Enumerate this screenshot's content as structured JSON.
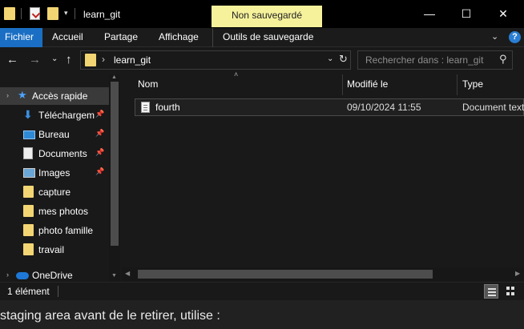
{
  "titlebar": {
    "title": "learn_git",
    "contextual_tab": "Non sauvegardé",
    "qa_dropdown": "▾",
    "controls": {
      "minimize": "—",
      "maximize": "☐",
      "close": "✕"
    }
  },
  "ribbon": {
    "tabs": [
      "Fichier",
      "Accueil",
      "Partage",
      "Affichage",
      "Outils de sauvegarde"
    ],
    "active_tab": "Fichier",
    "active_color": "#1a6fc4",
    "collapse_icon": "⌄",
    "help_icon": "?"
  },
  "navbar": {
    "back": "←",
    "forward": "→",
    "recent": "⌄",
    "up": "↑",
    "path_separator": "›",
    "path": "learn_git",
    "dropdown": "⌄",
    "refresh": "↻",
    "search_placeholder": "Rechercher dans : learn_git",
    "search_icon": "⚲"
  },
  "sidebar": {
    "items": [
      {
        "label": "Accès rapide",
        "icon": "star-icon",
        "glyph": "★",
        "pinned": false,
        "selected": true,
        "chevron": "›"
      },
      {
        "label": "Téléchargements",
        "icon": "download-icon",
        "glyph": "⬇",
        "pinned": true,
        "pin": "📌"
      },
      {
        "label": "Bureau",
        "icon": "desktop-icon",
        "pinned": true,
        "pin": "📌"
      },
      {
        "label": "Documents",
        "icon": "documents-icon",
        "pinned": true,
        "pin": "📌"
      },
      {
        "label": "Images",
        "icon": "images-icon",
        "pinned": true,
        "pin": "📌"
      },
      {
        "label": "capture",
        "icon": "folder-icon"
      },
      {
        "label": "mes photos",
        "icon": "folder-icon"
      },
      {
        "label": "photo famille",
        "icon": "folder-icon"
      },
      {
        "label": "travail",
        "icon": "folder-icon"
      },
      {
        "label": "OneDrive",
        "icon": "onedrive-icon",
        "chevron": "›"
      }
    ]
  },
  "filelist": {
    "columns": [
      "Nom",
      "Modifié le",
      "Type"
    ],
    "sort_indicator": "˄",
    "rows": [
      {
        "name": "fourth",
        "modified": "09/10/2024 11:55",
        "type": "Document texte"
      }
    ]
  },
  "statusbar": {
    "count": "1 élément"
  },
  "background_page": {
    "text": "staging area avant de le retirer, utilise :"
  },
  "colors": {
    "folder": "#f3d573",
    "accent": "#1a6fc4",
    "unsaved_tab": "#f6f29c"
  }
}
